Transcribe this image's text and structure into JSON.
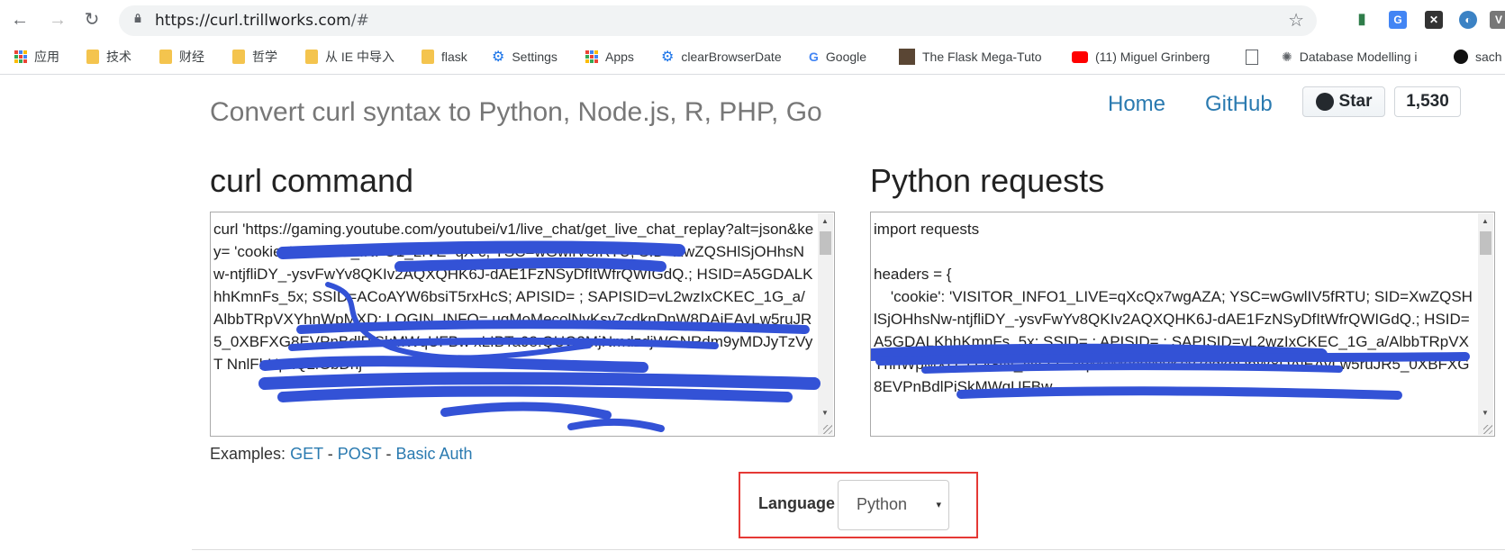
{
  "browser": {
    "url_host": "https://curl.trillworks.com",
    "url_path": "/#",
    "bookmarks": [
      "应用",
      "技术",
      "财经",
      "哲学",
      "从 IE 中导入",
      "flask",
      "Settings",
      "Apps",
      "clearBrowserDate",
      "Google",
      "The Flask Mega-Tuto",
      "(11) Miguel Grinberg",
      "Database Modelling i",
      "sach"
    ]
  },
  "header": {
    "title": "Convert curl syntax to Python, Node.js, R, PHP, Go",
    "nav": [
      "Home",
      "GitHub"
    ],
    "star_label": "Star",
    "star_count": "1,530"
  },
  "left": {
    "heading": "curl command",
    "text": "curl 'https://gaming.youtube.com/youtubei/v1/live_chat/get_live_chat_replay?alt=json&key= 'cookie: VISITOR_INFO1_LIVE=qX c; YSC=wGwlIV5fRTU; SID=XwZQSHlSjOHhsNw-ntjfliDY_-ysvFwYv8QKIv2AQXQHK6J-dAE1FzNSyDfItWfrQWIGdQ.; HSID=A5GDALKhhKmnFs_5x; SSID=ACoAYW6bsiT5rxHcS; APISID= ; SAPISID=vL2wzIxCKEC_1G_a/AlbbTRpVXYhnWpMXD; LOGIN_INFO= uqMoMecolNvKsv7cdknDnW8DAiEAyLw5ruJR5_0XBFXG8EVPnBdlPiSkMWqUFBw xLIBTa98:QUQ3MjNmdzdjWGNRdm9yMDJyTzVyT NnlFbUpxQ2lGbDhj"
  },
  "right": {
    "heading": "Python requests",
    "text": "import requests\n\nheaders = {\n    'cookie': 'VISITOR_INFO1_LIVE=qXcQx7wgAZA; YSC=wGwlIV5fRTU; SID=XwZQSHlSjOHhsNw-ntjfliDY_-ysvFwYv8QKIv2AQXQHK6J-dAE1FzNSyDfItWfrQWIGdQ.; HSID=A5GDALKhhKmnFs_5x; SSID= ; APISID= ; SAPISID=vL2wzIxCKEC_1G_a/AlbbTRpVXYhnWpMXD; LOGIN_INFO= uqMoMecolNvKsv7cdknDnW8DAiEAyLw5ruJR5_0XBFXG8EVPnBdlPiSkMWqUFBw"
  },
  "examples": {
    "label": "Examples:",
    "links": [
      "GET",
      "POST",
      "Basic Auth"
    ],
    "sep": "-"
  },
  "language": {
    "label": "Language",
    "selected": "Python",
    "caret": "▾"
  },
  "colors": {
    "link": "#2a7ab0",
    "scribble": "#3352d6",
    "highlight_border": "#e53935"
  }
}
